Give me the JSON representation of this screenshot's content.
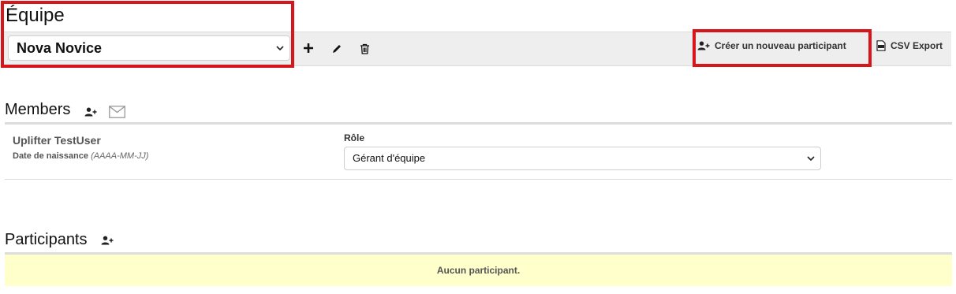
{
  "page": {
    "title": "Équipe"
  },
  "toolbar": {
    "team_selected": "Nova Novice",
    "add_label": "+",
    "create_participant_label": "Créer un nouveau participant",
    "csv_export_label": "CSV Export"
  },
  "members": {
    "heading": "Members",
    "items": [
      {
        "name": "Uplifter TestUser",
        "dob_label": "Date de naissance",
        "dob_format": "(AAAA-MM-JJ)",
        "role_label": "Rôle",
        "role_value": "Gérant d'équipe"
      }
    ]
  },
  "participants": {
    "heading": "Participants",
    "empty_message": "Aucun participant."
  },
  "colors": {
    "highlight": "#d7161b",
    "toolbar_bg": "#eeeeee",
    "empty_bg": "#ffffcc"
  }
}
